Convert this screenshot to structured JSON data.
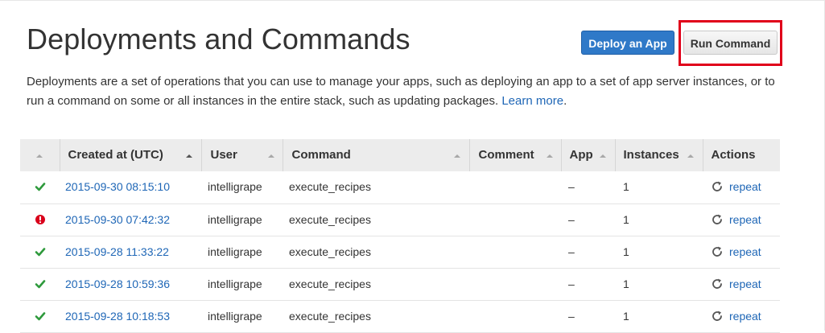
{
  "page": {
    "title": "Deployments and Commands",
    "description": "Deployments are a set of operations that you can use to manage your apps, such as deploying an app to a set of app server instances, or to run a command on some or all instances in the entire stack, such as updating packages.",
    "learn_more": "Learn more",
    "description_end": "."
  },
  "buttons": {
    "deploy": "Deploy an App",
    "run_command": "Run Command"
  },
  "colors": {
    "link": "#1e66b6",
    "primary_button": "#2f79c8",
    "highlight": "#e0001a",
    "success": "#2e9a3c",
    "error": "#d9001b"
  },
  "table": {
    "headers": {
      "created": "Created at (UTC)",
      "user": "User",
      "command": "Command",
      "comment": "Comment",
      "app": "App",
      "instances": "Instances",
      "actions": "Actions"
    },
    "rows": [
      {
        "status": "success",
        "status_icon": "check-icon",
        "created": "2015-09-30 08:15:10",
        "user": "intelligrape",
        "command": "execute_recipes",
        "comment": "",
        "app": "–",
        "instances": "1",
        "action": "repeat"
      },
      {
        "status": "error",
        "status_icon": "error-icon",
        "created": "2015-09-30 07:42:32",
        "user": "intelligrape",
        "command": "execute_recipes",
        "comment": "",
        "app": "–",
        "instances": "1",
        "action": "repeat"
      },
      {
        "status": "success",
        "status_icon": "check-icon",
        "created": "2015-09-28 11:33:22",
        "user": "intelligrape",
        "command": "execute_recipes",
        "comment": "",
        "app": "–",
        "instances": "1",
        "action": "repeat"
      },
      {
        "status": "success",
        "status_icon": "check-icon",
        "created": "2015-09-28 10:59:36",
        "user": "intelligrape",
        "command": "execute_recipes",
        "comment": "",
        "app": "–",
        "instances": "1",
        "action": "repeat"
      },
      {
        "status": "success",
        "status_icon": "check-icon",
        "created": "2015-09-28 10:18:53",
        "user": "intelligrape",
        "command": "execute_recipes",
        "comment": "",
        "app": "–",
        "instances": "1",
        "action": "repeat"
      }
    ]
  }
}
